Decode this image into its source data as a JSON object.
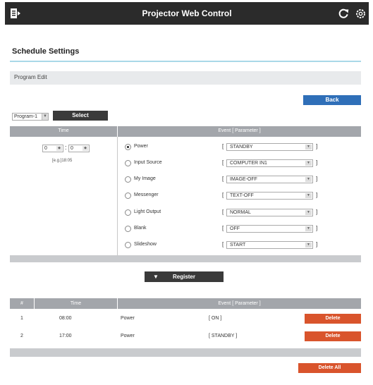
{
  "header": {
    "title": "Projector Web Control",
    "menu_icon": "menu-icon",
    "refresh_icon": "refresh-icon",
    "settings_icon": "gear-icon",
    "bg_color": "#2b2b2b"
  },
  "page": {
    "title": "Schedule Settings",
    "section": "Program Edit"
  },
  "back_button": "Back",
  "program": {
    "selected": "Program-1",
    "select_button": "Select"
  },
  "edit_grid": {
    "header_time": "Time",
    "header_event": "Event [ Parameter ]",
    "hour": "0",
    "minute": "0",
    "colon": ":",
    "hint": "[e.g.]18:05"
  },
  "events": [
    {
      "label": "Power",
      "value": "STANDBY",
      "selected": true
    },
    {
      "label": "Input Source",
      "value": "COMPUTER IN1",
      "selected": false
    },
    {
      "label": "My Image",
      "value": "IMAGE-OFF",
      "selected": false
    },
    {
      "label": "Messenger",
      "value": "TEXT-OFF",
      "selected": false
    },
    {
      "label": "Light Output",
      "value": "NORMAL",
      "selected": false
    },
    {
      "label": "Blank",
      "value": "OFF",
      "selected": false
    },
    {
      "label": "Slideshow",
      "value": "START",
      "selected": false
    }
  ],
  "register_button": "Register",
  "list": {
    "header": {
      "num": "#",
      "time": "Time",
      "event": "Event [ Parameter ]"
    },
    "rows": [
      {
        "num": "1",
        "time": "08:00",
        "event": "Power",
        "param": "[ ON ]",
        "action": "Delete"
      },
      {
        "num": "2",
        "time": "17:00",
        "event": "Power",
        "param": "[ STANDBY ]",
        "action": "Delete"
      }
    ]
  },
  "delete_all_button": "Delete All",
  "colors": {
    "accent_blue": "#2f6fb8",
    "delete_orange": "#d9542c",
    "table_header": "#a3a6ab"
  }
}
